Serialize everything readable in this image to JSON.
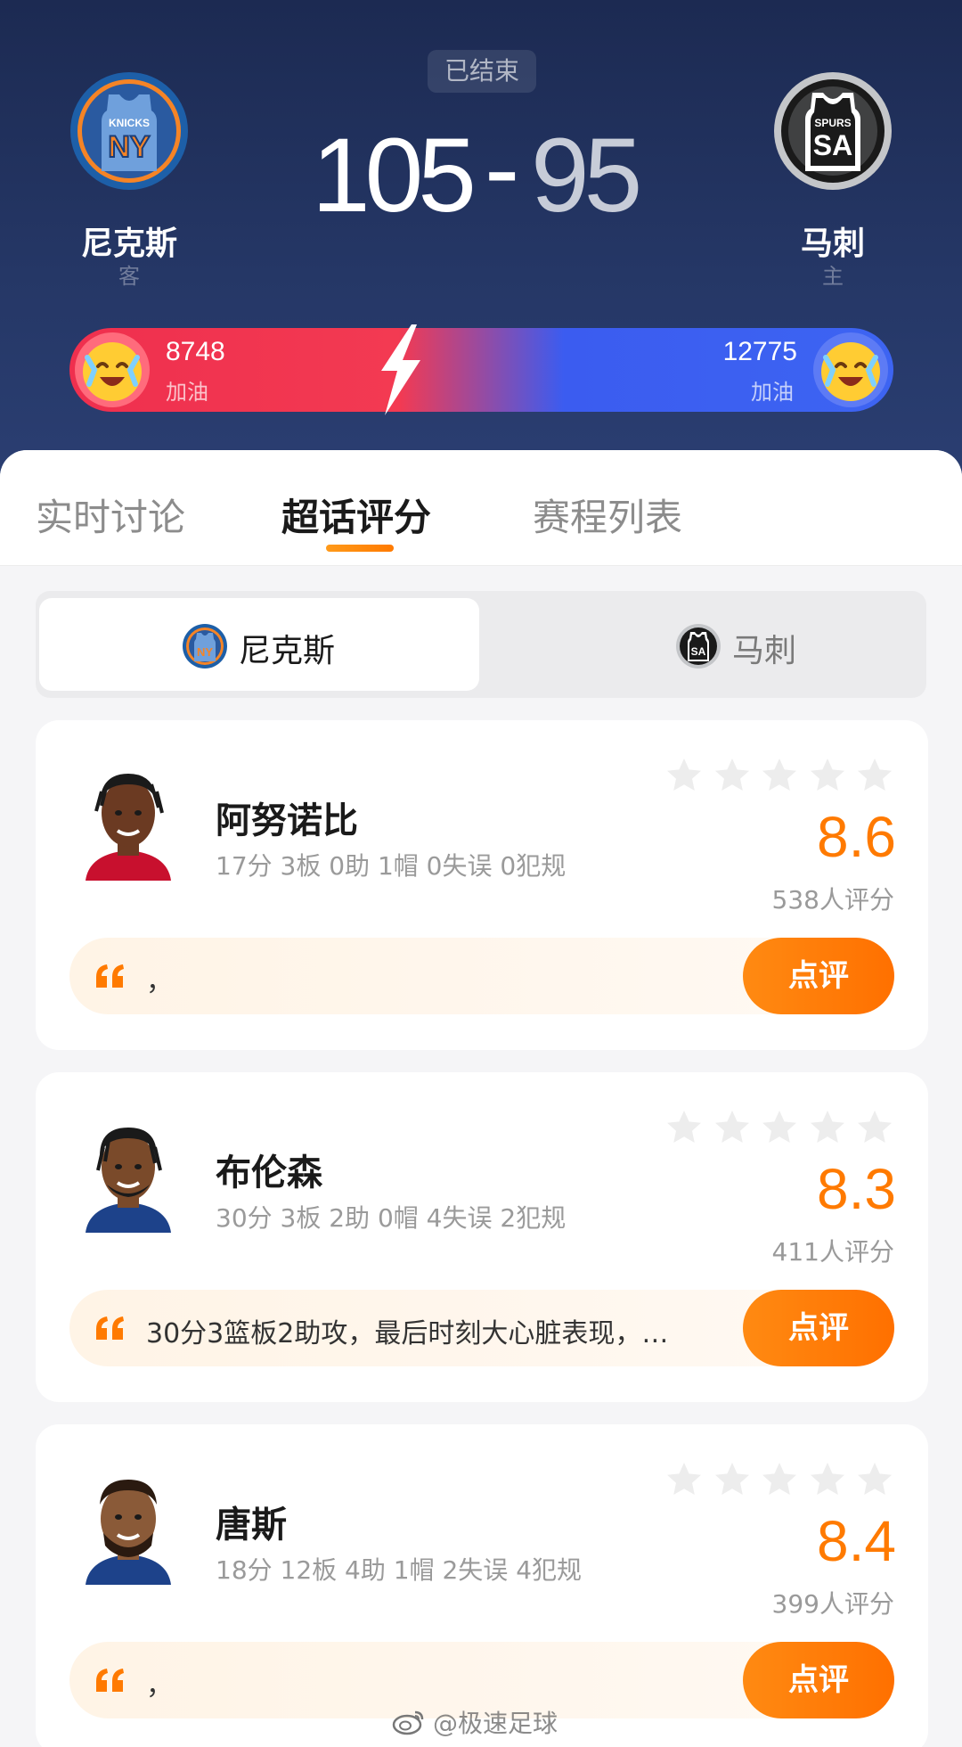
{
  "match": {
    "status": "已结束",
    "away": {
      "name": "尼克斯",
      "role": "客",
      "score": "105",
      "logo_text_top": "KNICKS",
      "logo_text_main": "NY"
    },
    "home": {
      "name": "马刺",
      "role": "主",
      "score": "95",
      "logo_text_top": "SPURS",
      "logo_text_main": "SA"
    },
    "score_separator": "-"
  },
  "cheer": {
    "away_count": "8748",
    "away_label": "加油",
    "home_count": "12775",
    "home_label": "加油",
    "away_color": "#ef2f4e",
    "home_color": "#3d64f2"
  },
  "tabs": [
    {
      "label": "实时讨论",
      "active": false
    },
    {
      "label": "超话评分",
      "active": true
    },
    {
      "label": "赛程列表",
      "active": false
    }
  ],
  "team_switch": [
    {
      "label": "尼克斯",
      "active": true
    },
    {
      "label": "马刺",
      "active": false
    }
  ],
  "players": [
    {
      "name": "阿努诺比",
      "stats": "17分 3板 0助 1帽 0失误 0犯规",
      "rating": "8.6",
      "rating_count": "538人评分",
      "comment": "，",
      "review_label": "点评"
    },
    {
      "name": "布伦森",
      "stats": "30分 3板 2助 0帽 4失误 2犯规",
      "rating": "8.3",
      "rating_count": "411人评分",
      "comment": "30分3篮板2助攻，最后时刻大心脏表现，…",
      "review_label": "点评"
    },
    {
      "name": "唐斯",
      "stats": "18分 12板 4助 1帽 2失误 4犯规",
      "rating": "8.4",
      "rating_count": "399人评分",
      "comment": "，",
      "review_label": "点评"
    }
  ],
  "watermark": "@极速足球",
  "accent_color": "#ff7a00"
}
